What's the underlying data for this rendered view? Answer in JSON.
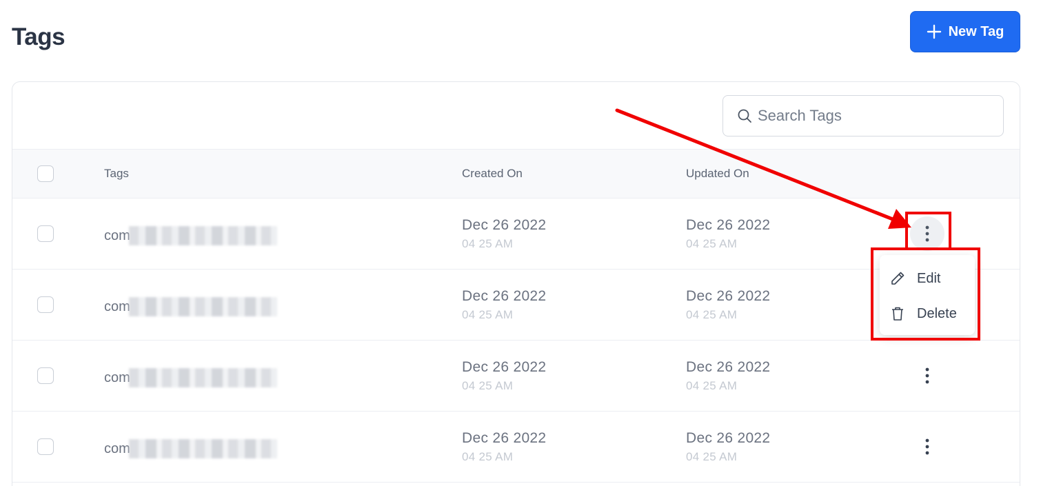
{
  "header": {
    "title": "Tags",
    "new_tag_label": "New Tag"
  },
  "search": {
    "placeholder": "Search Tags"
  },
  "table": {
    "columns": {
      "tags": "Tags",
      "created_on": "Created On",
      "updated_on": "Updated On"
    },
    "rows": [
      {
        "tag_prefix": "com",
        "created_date": "Dec 26 2022",
        "created_time": "04 25 AM",
        "updated_date": "Dec 26 2022",
        "updated_time": "04 25 AM"
      },
      {
        "tag_prefix": "com",
        "created_date": "Dec 26 2022",
        "created_time": "04 25 AM",
        "updated_date": "Dec 26 2022",
        "updated_time": "04 25 AM"
      },
      {
        "tag_prefix": "com",
        "created_date": "Dec 26 2022",
        "created_time": "04 25 AM",
        "updated_date": "Dec 26 2022",
        "updated_time": "04 25 AM"
      },
      {
        "tag_prefix": "com",
        "created_date": "Dec 26 2022",
        "created_time": "04 25 AM",
        "updated_date": "Dec 26 2022",
        "updated_time": "04 25 AM"
      }
    ]
  },
  "row_menu": {
    "edit_label": "Edit",
    "delete_label": "Delete"
  },
  "colors": {
    "primary": "#1f6bf2",
    "annotation": "#f00000"
  }
}
